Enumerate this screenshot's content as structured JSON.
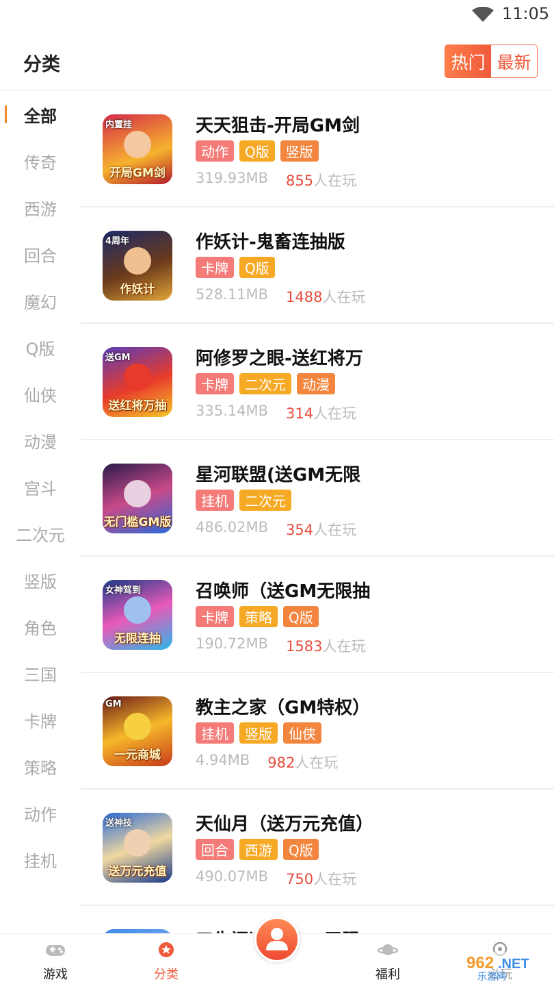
{
  "status_bar": {
    "time": "11:05"
  },
  "header": {
    "title": "分类",
    "sort_hot": "热门",
    "sort_new": "最新"
  },
  "categories": [
    "全部",
    "传奇",
    "西游",
    "回合",
    "魔幻",
    "Q版",
    "仙侠",
    "动漫",
    "宫斗",
    "二次元",
    "竖版",
    "角色",
    "三国",
    "卡牌",
    "策略",
    "动作",
    "挂机"
  ],
  "games": [
    {
      "title": "天天狙击-开局GM剑",
      "tags": [
        "动作",
        "Q版",
        "竖版"
      ],
      "size": "319.93MB",
      "players": "855",
      "players_suffix": "人在玩",
      "icon_text": "开局GM剑",
      "icon_top": "内置挂"
    },
    {
      "title": "作妖计-鬼畜连抽版",
      "tags": [
        "卡牌",
        "Q版"
      ],
      "size": "528.11MB",
      "players": "1488",
      "players_suffix": "人在玩",
      "icon_text": "作妖计",
      "icon_top": "4周年"
    },
    {
      "title": "阿修罗之眼-送红将万",
      "tags": [
        "卡牌",
        "二次元",
        "动漫"
      ],
      "size": "335.14MB",
      "players": "314",
      "players_suffix": "人在玩",
      "icon_text": "送红将万抽",
      "icon_top": "送GM"
    },
    {
      "title": "星河联盟(送GM无限",
      "tags": [
        "挂机",
        "二次元"
      ],
      "size": "486.02MB",
      "players": "354",
      "players_suffix": "人在玩",
      "icon_text": "无门槛GM版",
      "icon_top": ""
    },
    {
      "title": "召唤师（送GM无限抽",
      "tags": [
        "卡牌",
        "策略",
        "Q版"
      ],
      "size": "190.72MB",
      "players": "1583",
      "players_suffix": "人在玩",
      "icon_text": "无限连抽",
      "icon_top": "女神驾到"
    },
    {
      "title": "教主之家（GM特权）",
      "tags": [
        "挂机",
        "竖版",
        "仙侠"
      ],
      "size": "4.94MB",
      "players": "982",
      "players_suffix": "人在玩",
      "icon_text": "一元商城",
      "icon_top": "GM"
    },
    {
      "title": "天仙月（送万元充值）",
      "tags": [
        "回合",
        "西游",
        "Q版"
      ],
      "size": "490.07MB",
      "players": "750",
      "players_suffix": "人在玩",
      "icon_text": "送万元充值",
      "icon_top": "送神技"
    },
    {
      "title": "三生问道-送GM无限",
      "tags": [],
      "size": "",
      "players": "",
      "players_suffix": "",
      "icon_text": "",
      "icon_top": ""
    }
  ],
  "tabbar": {
    "games": "游戏",
    "category": "分类",
    "mine": "我的",
    "welfare": "福利",
    "more": "必玩"
  },
  "watermark": "962.NET 乐游网",
  "colors": {
    "accent": "#ef5a3b",
    "tag_red": "#f47b78",
    "tag_yellow": "#f6a924",
    "tag_orange": "#f2863f"
  }
}
